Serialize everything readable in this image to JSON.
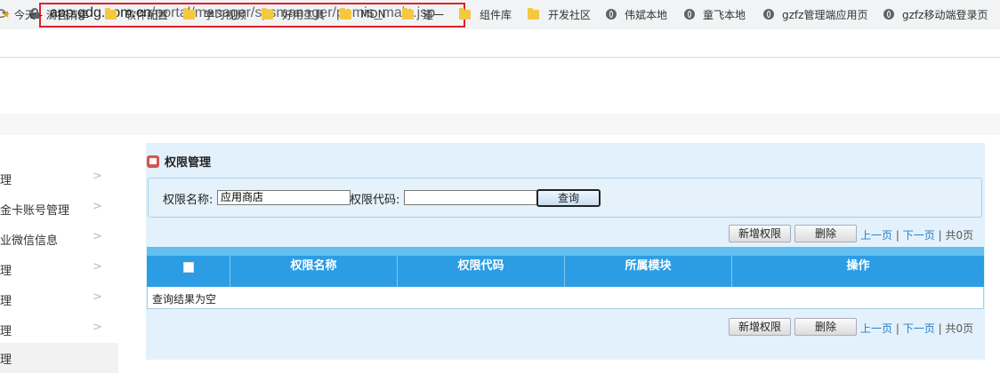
{
  "browser": {
    "url_host": "app.gdg.com.cn",
    "url_path": "/portal/manager/sysmanager/pemis_main.jsp"
  },
  "bookmarks": [
    {
      "label": "今天 - 滴答清单",
      "icon": "star-icon"
    },
    {
      "label": "软件配置",
      "icon": "folder-icon"
    },
    {
      "label": "学习视频",
      "icon": "folder-icon"
    },
    {
      "label": "好用工具",
      "icon": "folder-icon"
    },
    {
      "label": "MDN",
      "icon": "folder-icon"
    },
    {
      "label": "道一",
      "icon": "folder-icon"
    },
    {
      "label": "组件库",
      "icon": "folder-icon"
    },
    {
      "label": "开发社区",
      "icon": "folder-icon"
    },
    {
      "label": "伟斌本地",
      "icon": "globe-icon"
    },
    {
      "label": "童飞本地",
      "icon": "globe-icon"
    },
    {
      "label": "gzfz管理端应用页",
      "icon": "globe-icon"
    },
    {
      "label": "gzfz移动端登录页",
      "icon": "globe-icon"
    }
  ],
  "sidebar": {
    "items": [
      {
        "label": "理"
      },
      {
        "label": "金卡账号管理"
      },
      {
        "label": "业微信信息"
      },
      {
        "label": "理"
      },
      {
        "label": "理"
      },
      {
        "label": "理"
      },
      {
        "label": "理"
      }
    ]
  },
  "panel": {
    "title": "权限管理",
    "search": {
      "name_label": "权限名称:",
      "name_value": "应用商店",
      "code_label": "权限代码:",
      "code_value": "",
      "query_button": "查询"
    },
    "toolbar": {
      "add_label": "新增权限",
      "delete_label": "删除",
      "prev_label": "上一页",
      "next_label": "下一页",
      "sep": "|",
      "total_label": "共0页"
    },
    "table": {
      "columns": [
        "权限名称",
        "权限代码",
        "所属模块",
        "操作"
      ],
      "empty_text": "查询结果为空"
    }
  },
  "colors": {
    "header_blue": "#2d9de4",
    "panel_bg": "#e2f1fb",
    "link_blue": "#2a7ec7",
    "url_highlight": "#e0202a"
  }
}
